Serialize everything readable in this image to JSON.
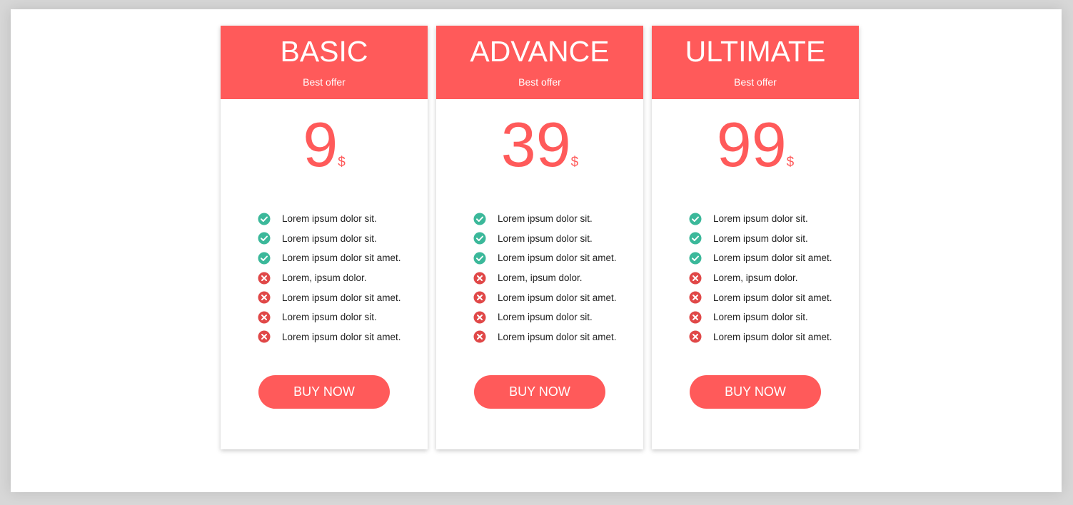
{
  "colors": {
    "accent": "#ff5a5a",
    "check": "#3bb89a",
    "cross": "#e04848"
  },
  "plans": [
    {
      "name": "BASIC",
      "subtitle": "Best offer",
      "price": "9",
      "currency": "$",
      "features": [
        {
          "text": "Lorem ipsum dolor sit.",
          "included": true
        },
        {
          "text": "Lorem ipsum dolor sit.",
          "included": true
        },
        {
          "text": "Lorem ipsum dolor sit amet.",
          "included": true
        },
        {
          "text": "Lorem, ipsum dolor.",
          "included": false
        },
        {
          "text": "Lorem ipsum dolor sit amet.",
          "included": false
        },
        {
          "text": "Lorem ipsum dolor sit.",
          "included": false
        },
        {
          "text": "Lorem ipsum dolor sit amet.",
          "included": false
        }
      ],
      "button_label": "BUY NOW"
    },
    {
      "name": "ADVANCE",
      "subtitle": "Best offer",
      "price": "39",
      "currency": "$",
      "features": [
        {
          "text": "Lorem ipsum dolor sit.",
          "included": true
        },
        {
          "text": "Lorem ipsum dolor sit.",
          "included": true
        },
        {
          "text": "Lorem ipsum dolor sit amet.",
          "included": true
        },
        {
          "text": "Lorem, ipsum dolor.",
          "included": false
        },
        {
          "text": "Lorem ipsum dolor sit amet.",
          "included": false
        },
        {
          "text": "Lorem ipsum dolor sit.",
          "included": false
        },
        {
          "text": "Lorem ipsum dolor sit amet.",
          "included": false
        }
      ],
      "button_label": "BUY NOW"
    },
    {
      "name": "ULTIMATE",
      "subtitle": "Best offer",
      "price": "99",
      "currency": "$",
      "features": [
        {
          "text": "Lorem ipsum dolor sit.",
          "included": true
        },
        {
          "text": "Lorem ipsum dolor sit.",
          "included": true
        },
        {
          "text": "Lorem ipsum dolor sit amet.",
          "included": true
        },
        {
          "text": "Lorem, ipsum dolor.",
          "included": false
        },
        {
          "text": "Lorem ipsum dolor sit amet.",
          "included": false
        },
        {
          "text": "Lorem ipsum dolor sit.",
          "included": false
        },
        {
          "text": "Lorem ipsum dolor sit amet.",
          "included": false
        }
      ],
      "button_label": "BUY NOW"
    }
  ]
}
